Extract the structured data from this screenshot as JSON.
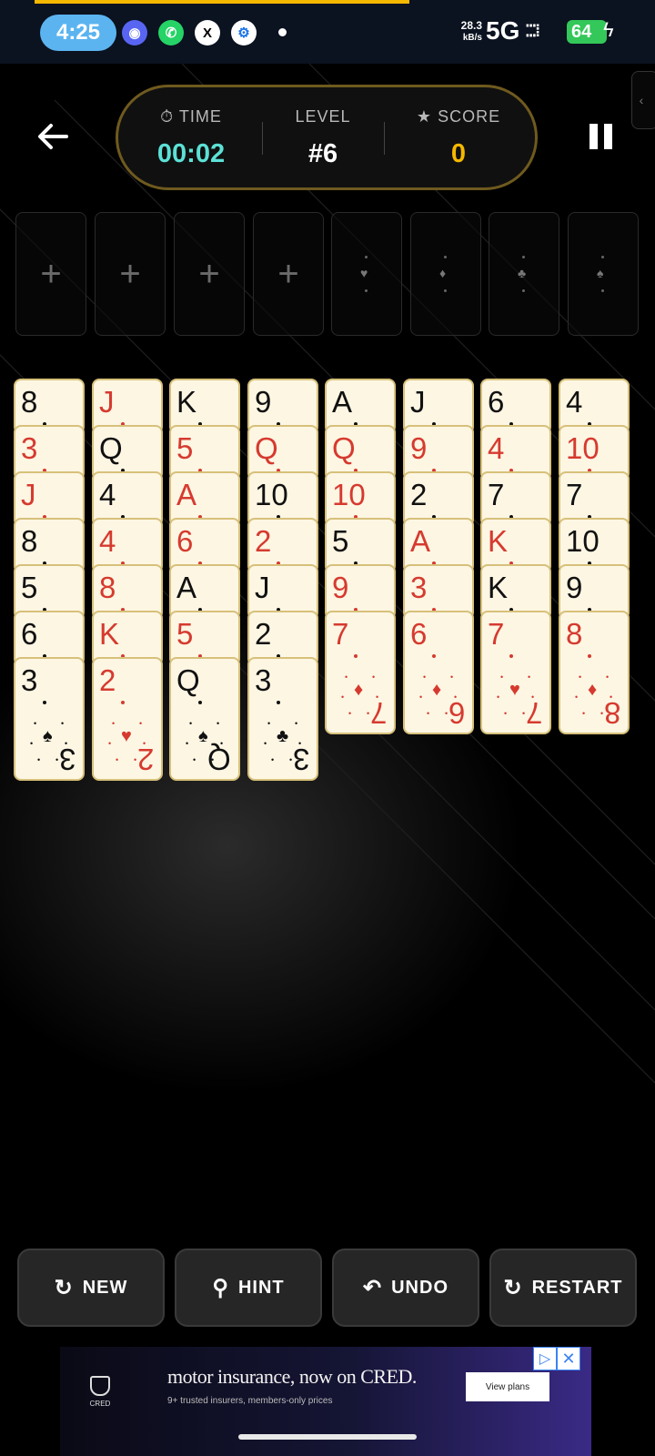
{
  "status_bar": {
    "time": "4:25",
    "net_speed_value": "28.3",
    "net_speed_unit": "kB/s",
    "network": "5G",
    "battery": "64",
    "icons": [
      "discord-icon",
      "whatsapp-icon",
      "x-icon",
      "chrome-settings-icon"
    ]
  },
  "header": {
    "time_label": "TIME",
    "time_value": "00:02",
    "level_label": "LEVEL",
    "level_value": "#6",
    "score_label": "SCORE",
    "score_value": "0",
    "colors": {
      "time": "#5ce1d6",
      "score": "#f5b800",
      "accent": "#f5b800"
    }
  },
  "free_cells": [
    "+",
    "+",
    "+",
    "+"
  ],
  "foundations": [
    "♥",
    "♦",
    "♣",
    "♠"
  ],
  "tableau": [
    {
      "cards": [
        {
          "r": "8",
          "c": "black",
          "s": "♠"
        },
        {
          "r": "3",
          "c": "red",
          "s": "♦"
        },
        {
          "r": "J",
          "c": "red",
          "s": "♦"
        },
        {
          "r": "8",
          "c": "black",
          "s": "♠"
        },
        {
          "r": "5",
          "c": "black",
          "s": "♠"
        },
        {
          "r": "6",
          "c": "black",
          "s": "♠"
        },
        {
          "r": "3",
          "c": "black",
          "s": "♠"
        }
      ]
    },
    {
      "cards": [
        {
          "r": "J",
          "c": "red",
          "s": "♥"
        },
        {
          "r": "Q",
          "c": "black",
          "s": "♠"
        },
        {
          "r": "4",
          "c": "black",
          "s": "♠"
        },
        {
          "r": "4",
          "c": "red",
          "s": "♦"
        },
        {
          "r": "8",
          "c": "red",
          "s": "♥"
        },
        {
          "r": "K",
          "c": "red",
          "s": "♥"
        },
        {
          "r": "2",
          "c": "red",
          "s": "♥"
        }
      ]
    },
    {
      "cards": [
        {
          "r": "K",
          "c": "black",
          "s": "♠"
        },
        {
          "r": "5",
          "c": "red",
          "s": "♦"
        },
        {
          "r": "A",
          "c": "red",
          "s": "♦"
        },
        {
          "r": "6",
          "c": "red",
          "s": "♦"
        },
        {
          "r": "A",
          "c": "black",
          "s": "♠"
        },
        {
          "r": "5",
          "c": "red",
          "s": "♥"
        },
        {
          "r": "Q",
          "c": "black",
          "s": "♠"
        }
      ]
    },
    {
      "cards": [
        {
          "r": "9",
          "c": "black",
          "s": "♠"
        },
        {
          "r": "Q",
          "c": "red",
          "s": "♥"
        },
        {
          "r": "10",
          "c": "black",
          "s": "♠"
        },
        {
          "r": "2",
          "c": "red",
          "s": "♦"
        },
        {
          "r": "J",
          "c": "black",
          "s": "♠"
        },
        {
          "r": "2",
          "c": "black",
          "s": "♠"
        },
        {
          "r": "3",
          "c": "black",
          "s": "♣"
        }
      ]
    },
    {
      "cards": [
        {
          "r": "A",
          "c": "black",
          "s": "♠"
        },
        {
          "r": "Q",
          "c": "red",
          "s": "♦"
        },
        {
          "r": "10",
          "c": "red",
          "s": "♦"
        },
        {
          "r": "5",
          "c": "black",
          "s": "♠"
        },
        {
          "r": "9",
          "c": "red",
          "s": "♦"
        },
        {
          "r": "7",
          "c": "red",
          "s": "♦"
        }
      ]
    },
    {
      "cards": [
        {
          "r": "J",
          "c": "black",
          "s": "♠"
        },
        {
          "r": "9",
          "c": "red",
          "s": "♥"
        },
        {
          "r": "2",
          "c": "black",
          "s": "♠"
        },
        {
          "r": "A",
          "c": "red",
          "s": "♦"
        },
        {
          "r": "3",
          "c": "red",
          "s": "♦"
        },
        {
          "r": "6",
          "c": "red",
          "s": "♦"
        }
      ]
    },
    {
      "cards": [
        {
          "r": "6",
          "c": "black",
          "s": "♠"
        },
        {
          "r": "4",
          "c": "red",
          "s": "♦"
        },
        {
          "r": "7",
          "c": "black",
          "s": "♠"
        },
        {
          "r": "K",
          "c": "red",
          "s": "♦"
        },
        {
          "r": "K",
          "c": "black",
          "s": "♠"
        },
        {
          "r": "7",
          "c": "red",
          "s": "♥"
        }
      ]
    },
    {
      "cards": [
        {
          "r": "4",
          "c": "black",
          "s": "♠"
        },
        {
          "r": "10",
          "c": "red",
          "s": "♦"
        },
        {
          "r": "7",
          "c": "black",
          "s": "♠"
        },
        {
          "r": "10",
          "c": "black",
          "s": "♠"
        },
        {
          "r": "9",
          "c": "black",
          "s": "♠"
        },
        {
          "r": "8",
          "c": "red",
          "s": "♦"
        }
      ]
    }
  ],
  "actions": {
    "new_label": "NEW",
    "hint_label": "HINT",
    "undo_label": "UNDO",
    "restart_label": "RESTART"
  },
  "ad": {
    "brand": "CRED",
    "headline": "motor insurance, now on CRED.",
    "subtext": "9+ trusted insurers, members-only prices",
    "cta": "View plans"
  }
}
